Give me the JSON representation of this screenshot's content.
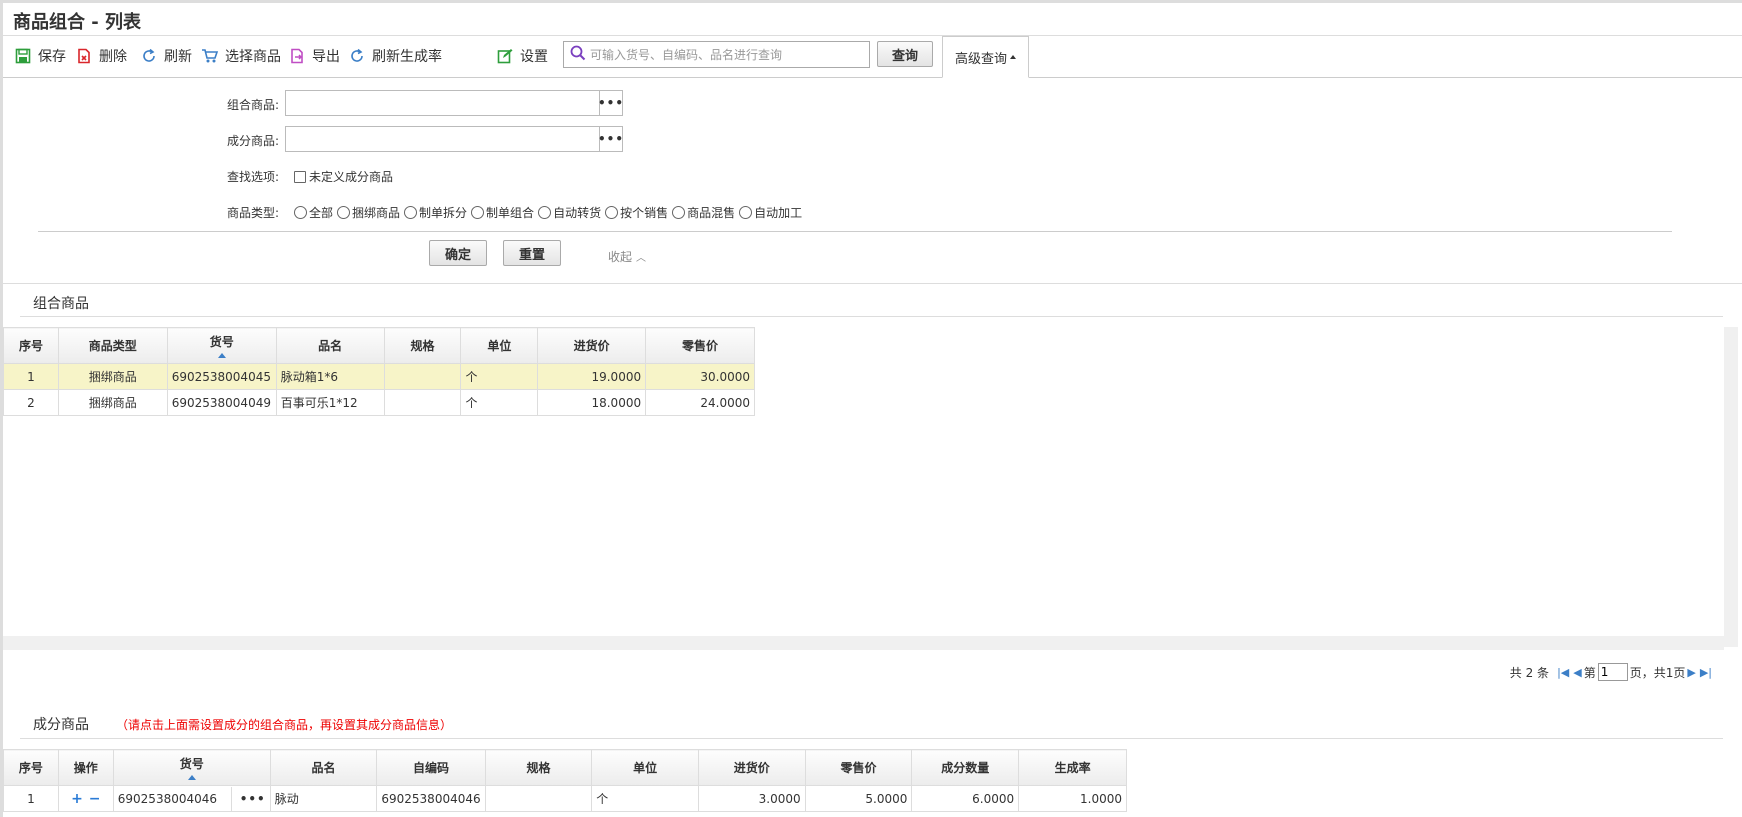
{
  "page": {
    "title": "商品组合 - 列表"
  },
  "toolbar": {
    "save": "保存",
    "delete": "删除",
    "refresh": "刷新",
    "select_goods": "选择商品",
    "export": "导出",
    "refresh_rate": "刷新生成率",
    "settings": "设置",
    "search_placeholder": "可输入货号、自编码、品名进行查询",
    "query": "查询",
    "advanced": "高级查询"
  },
  "advanced": {
    "combo_goods_label": "组合商品:",
    "component_goods_label": "成分商品:",
    "search_options_label": "查找选项:",
    "undefined_component": "未定义成分商品",
    "goods_type_label": "商品类型:",
    "goods_types": [
      "全部",
      "捆绑商品",
      "制单拆分",
      "制单组合",
      "自动转货",
      "按个销售",
      "商品混售",
      "自动加工"
    ],
    "confirm": "确定",
    "reset": "重置",
    "collapse": "收起"
  },
  "combo_section": {
    "title": "组合商品",
    "columns": [
      "序号",
      "商品类型",
      "货号",
      "品名",
      "规格",
      "单位",
      "进货价",
      "零售价"
    ],
    "rows": [
      [
        "1",
        "捆绑商品",
        "6902538004045",
        "脉动箱1*6",
        "",
        "个",
        "19.0000",
        "30.0000"
      ],
      [
        "2",
        "捆绑商品",
        "6902538004049",
        "百事可乐1*12",
        "",
        "个",
        "18.0000",
        "24.0000"
      ]
    ]
  },
  "pager": {
    "total": "共 2 条",
    "page_prefix": "第",
    "page_value": "1",
    "page_suffix": "页，共1页"
  },
  "component_section": {
    "title": "成分商品",
    "hint": "（请点击上面需设置成分的组合商品，再设置其成分商品信息）",
    "columns": [
      "序号",
      "操作",
      "货号",
      "品名",
      "自编码",
      "规格",
      "单位",
      "进货价",
      "零售价",
      "成分数量",
      "生成率"
    ],
    "rows": [
      [
        "1",
        "",
        "6902538004046",
        "脉动",
        "6902538004046",
        "",
        "个",
        "3.0000",
        "5.0000",
        "6.0000",
        "1.0000"
      ]
    ]
  },
  "colors": {
    "accent": "#3c7fc7",
    "highlight_row": "#f7f4c8",
    "hint": "#ee0000"
  }
}
